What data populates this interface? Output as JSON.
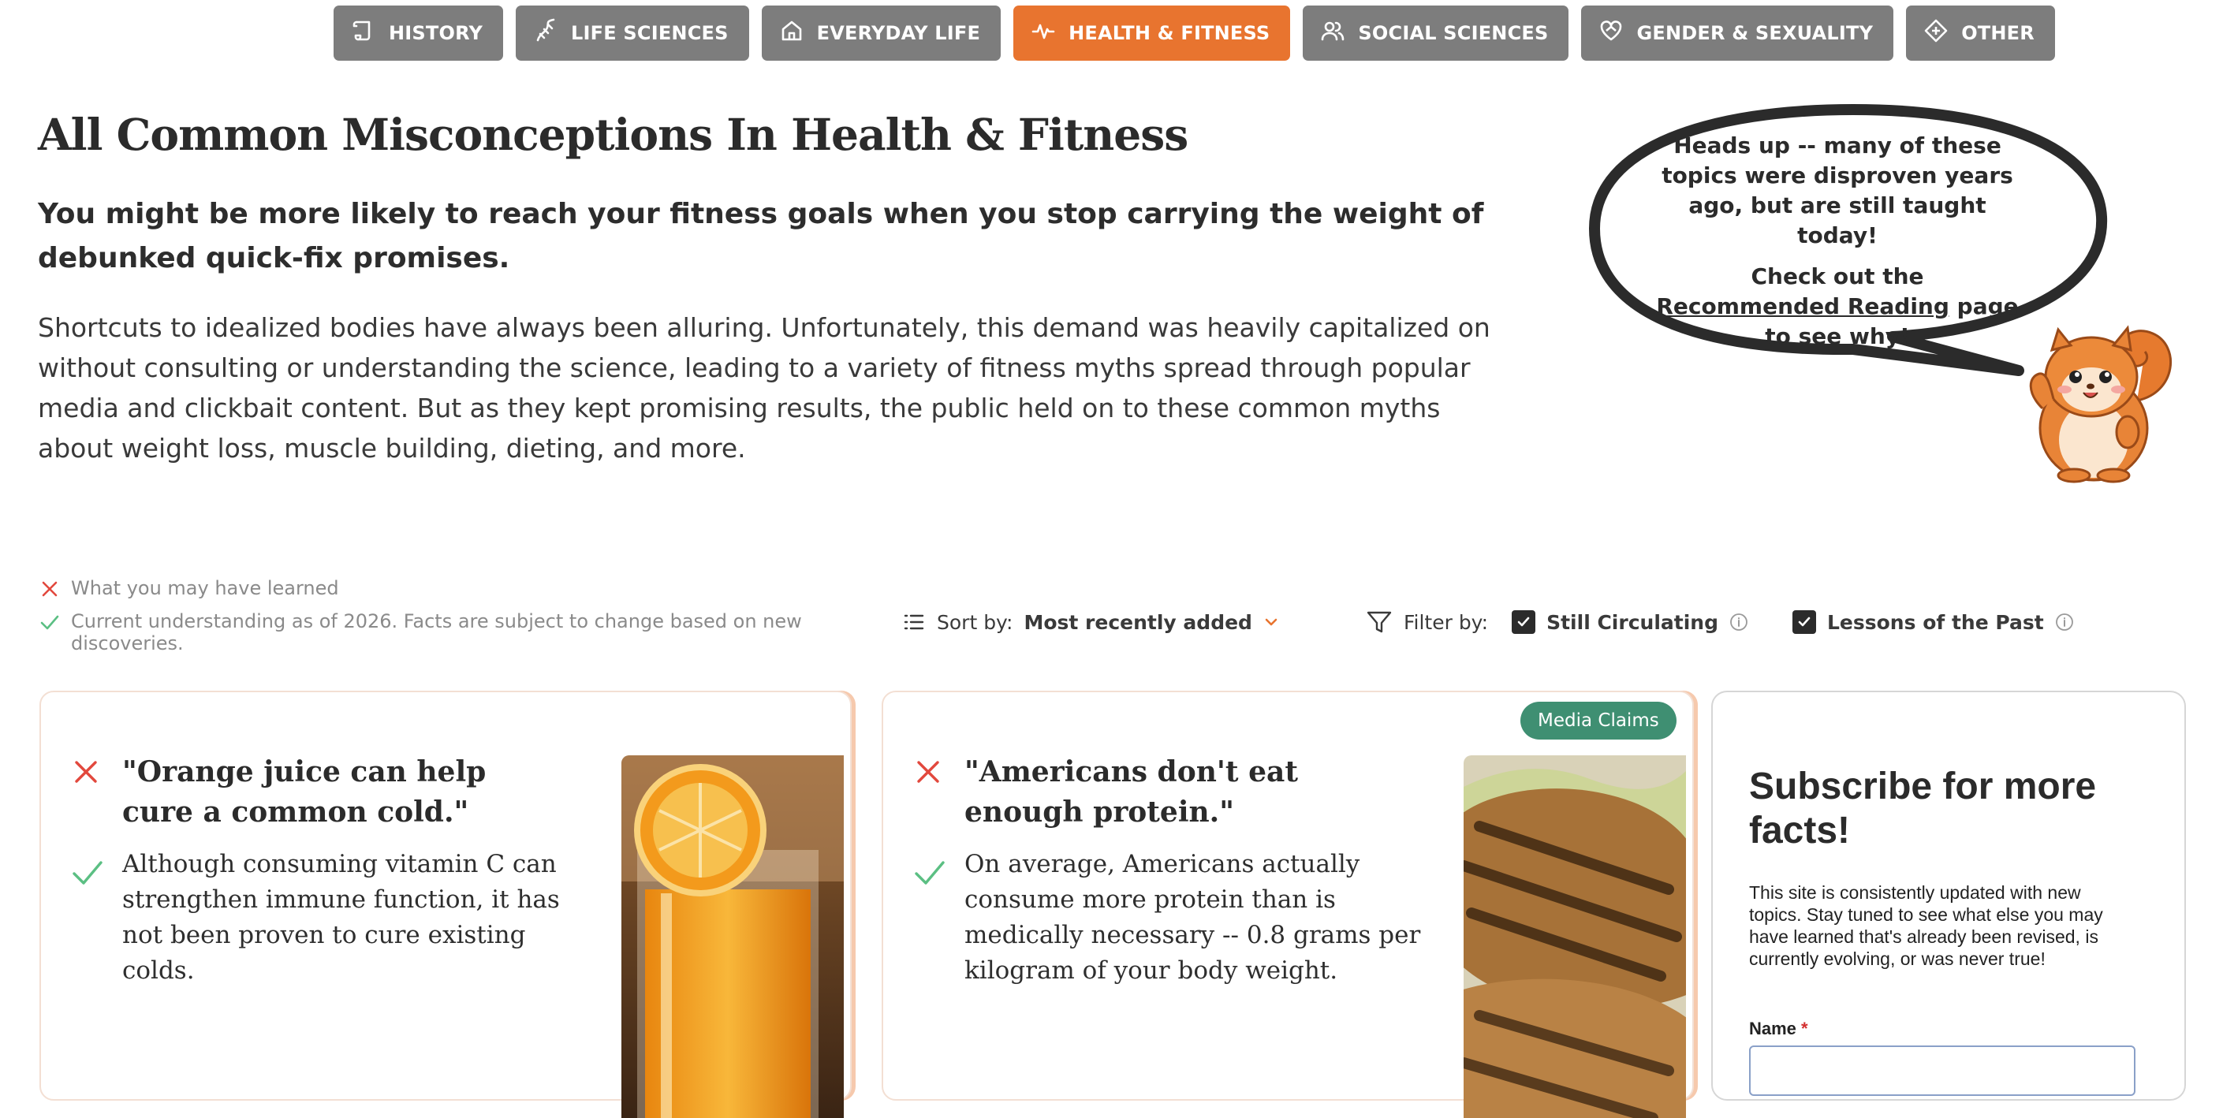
{
  "tabs": [
    {
      "label": "HISTORY",
      "icon": "scroll-icon",
      "active": false
    },
    {
      "label": "LIFE SCIENCES",
      "icon": "dna-icon",
      "active": false
    },
    {
      "label": "EVERYDAY LIFE",
      "icon": "home-icon",
      "active": false
    },
    {
      "label": "HEALTH & FITNESS",
      "icon": "pulse-icon",
      "active": true
    },
    {
      "label": "SOCIAL SCIENCES",
      "icon": "people-icon",
      "active": false
    },
    {
      "label": "GENDER & SEXUALITY",
      "icon": "heart-hands-icon",
      "active": false
    },
    {
      "label": "OTHER",
      "icon": "diamond-icon",
      "active": false
    }
  ],
  "colors": {
    "tab_default": "#7d7d7d",
    "tab_active": "#e8742f",
    "tag": "#3f8f72",
    "cross": "#e2483d",
    "check": "#5bbf83"
  },
  "page": {
    "title": "All Common Misconceptions In Health & Fitness",
    "lead": "You might be more likely to reach your fitness goals when you stop carrying the weight of debunked quick-fix promises.",
    "intro": "Shortcuts to idealized bodies have always been alluring. Unfortunately, this demand was heavily capitalized on without consulting or understanding the science, leading to a variety of fitness myths spread through popular media and clickbait content. But as they kept promising results, the public held on to these common myths about weight loss, muscle building, dieting, and more."
  },
  "bubble": {
    "line1": "Heads up -- many of these topics were disproven years ago, but are still taught today!",
    "line2_prefix": "Check out the",
    "link": "Recommended Reading",
    "line2_suffix": "page to see why!"
  },
  "legend": {
    "learned": "What you may have learned",
    "current": "Current understanding as of 2026. Facts are subject to change based on new discoveries."
  },
  "controls": {
    "sort_label": "Sort by:",
    "sort_value": "Most recently added",
    "filter_label": "Filter by:",
    "filters": [
      {
        "label": "Still Circulating",
        "checked": true
      },
      {
        "label": "Lessons of the Past",
        "checked": true
      }
    ]
  },
  "cards": [
    {
      "claim": "\"Orange juice can help cure a common cold.\"",
      "fact": "Although consuming vitamin C can strengthen immune function, it has not been proven to cure existing colds.",
      "image": "orange-juice-photo"
    },
    {
      "tag": "Media Claims",
      "claim": "\"Americans don't eat enough protein.\"",
      "fact": "On average, Americans actually consume more protein than is medically necessary -- 0.8 grams per kilogram of your body weight.",
      "image": "grilled-chicken-photo"
    }
  ],
  "subscribe": {
    "title": "Subscribe for more facts!",
    "text": "This site is consistently updated with new topics. Stay tuned to see what else you may have learned that's already been revised, is currently evolving, or was never true!",
    "name_label": "Name",
    "required_mark": "*"
  }
}
